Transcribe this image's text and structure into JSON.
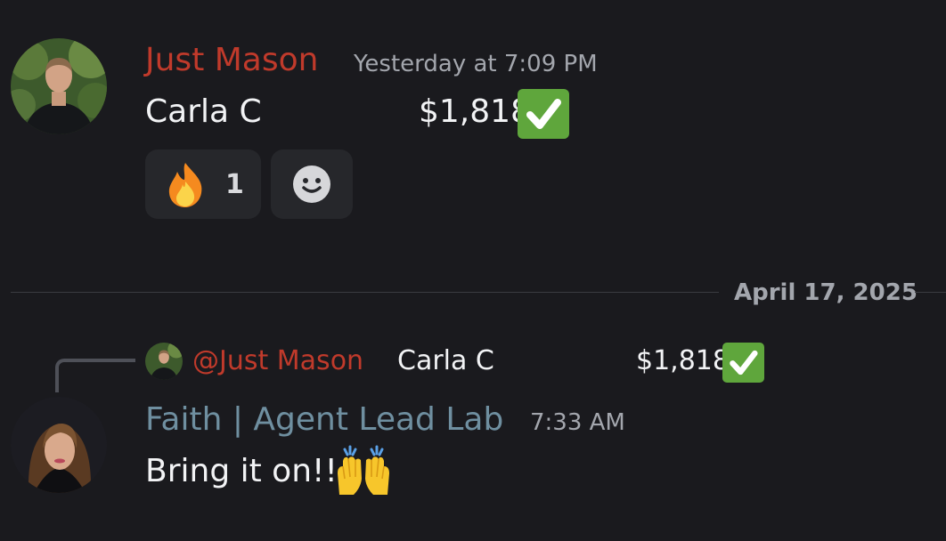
{
  "messages": [
    {
      "author": "Just Mason",
      "author_color": "#c03a2b",
      "timestamp": "Yesterday at 7:09 PM",
      "text_name": "Carla C",
      "text_amount": "$1,818",
      "status_icon": "white-check-mark-icon",
      "reactions": [
        {
          "icon": "fire-emoji-icon",
          "count": "1"
        },
        {
          "icon": "add-reaction-smiley-icon"
        }
      ]
    },
    {
      "reply": {
        "mention": "@Just Mason",
        "mention_color": "#c03a2b",
        "text_name": "Carla C",
        "text_amount": "$1,818",
        "status_icon": "white-check-mark-icon"
      },
      "author": "Faith | Agent Lead Lab",
      "author_color": "#6f8fa0",
      "timestamp": "7:33 AM",
      "text": "Bring it on!!",
      "emoji_icon": "raising-hands-emoji-icon"
    }
  ],
  "divider": {
    "date": "April 17, 2025"
  }
}
